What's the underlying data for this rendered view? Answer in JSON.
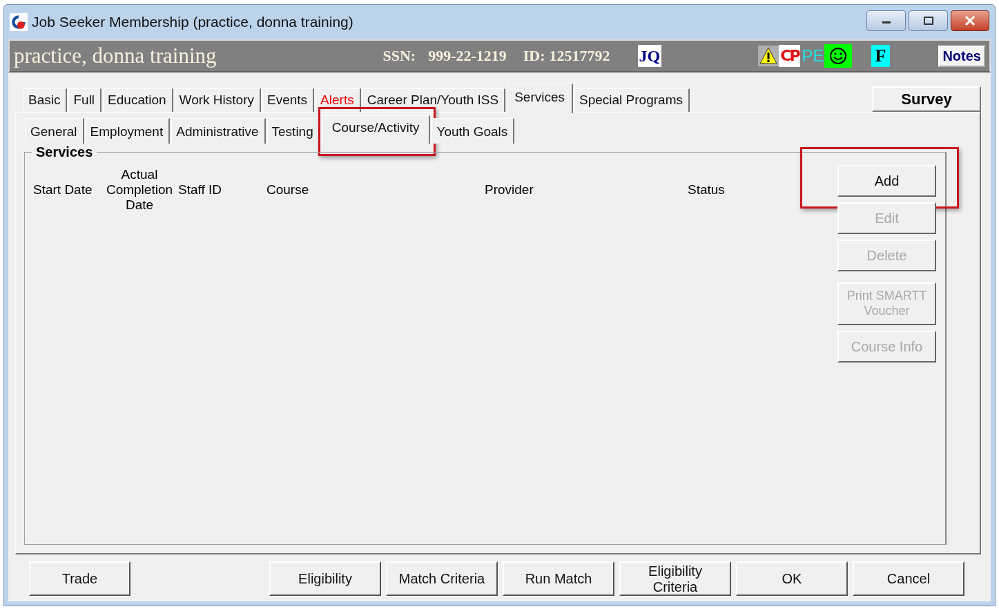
{
  "window": {
    "title": "Job Seeker Membership (practice, donna training)"
  },
  "header": {
    "name": "practice, donna training",
    "ssn_label": "SSN:",
    "ssn": "999-22-1219",
    "id_label": "ID:",
    "id": "12517792",
    "badges": [
      {
        "kind": "text",
        "label": "JQ"
      },
      {
        "kind": "warning"
      },
      {
        "kind": "cp",
        "label": "CP"
      },
      {
        "kind": "pe",
        "label": "PE"
      },
      {
        "kind": "smiley"
      },
      {
        "kind": "f",
        "label": "F"
      }
    ],
    "notes_button": "Notes"
  },
  "tabs": [
    {
      "label": "Basic",
      "selected": false,
      "alert": false
    },
    {
      "label": "Full",
      "selected": false,
      "alert": false
    },
    {
      "label": "Education",
      "selected": false,
      "alert": false
    },
    {
      "label": "Work History",
      "selected": false,
      "alert": false
    },
    {
      "label": "Events",
      "selected": false,
      "alert": false
    },
    {
      "label": "Alerts",
      "selected": false,
      "alert": true
    },
    {
      "label": "Career Plan/Youth ISS",
      "selected": false,
      "alert": false
    },
    {
      "label": "Services",
      "selected": true,
      "alert": false
    },
    {
      "label": "Special Programs",
      "selected": false,
      "alert": false
    }
  ],
  "survey_button": "Survey",
  "subtabs": [
    {
      "label": "General",
      "selected": false,
      "highlighted": false
    },
    {
      "label": "Employment",
      "selected": false,
      "highlighted": false
    },
    {
      "label": "Administrative",
      "selected": false,
      "highlighted": false
    },
    {
      "label": "Testing",
      "selected": false,
      "highlighted": false
    },
    {
      "label": "Course/Activity",
      "selected": true,
      "highlighted": true
    },
    {
      "label": "Youth Goals",
      "selected": false,
      "highlighted": false
    }
  ],
  "services": {
    "title": "Services",
    "columns": [
      "Start Date",
      "Actual Completion Date",
      "Staff ID",
      "Course",
      "Provider",
      "Status"
    ],
    "buttons": [
      {
        "label": "Add",
        "disabled": false,
        "highlighted": true
      },
      {
        "label": "Edit",
        "disabled": true,
        "highlighted": false
      },
      {
        "label": "Delete",
        "disabled": true,
        "highlighted": false
      },
      {
        "label": "Print SMARTT Voucher",
        "disabled": true,
        "highlighted": false
      },
      {
        "label": "Course Info",
        "disabled": true,
        "highlighted": false
      }
    ]
  },
  "left_buttons": [
    "Trade"
  ],
  "right_buttons": [
    "Eligibility",
    "Match Criteria",
    "Run Match",
    "Eligibility Criteria",
    "OK",
    "Cancel"
  ]
}
